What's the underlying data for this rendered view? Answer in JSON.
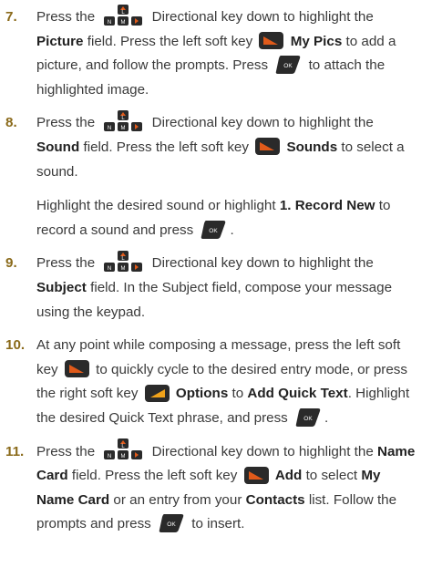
{
  "colors": {
    "step_number": "#8a6a1a",
    "text": "#3a3a3a",
    "key_dark": "#2a2a2a",
    "key_accent": "#e05a1a"
  },
  "icons": {
    "directional": "directional-key-icon",
    "left_soft": "left-soft-key-icon",
    "right_soft": "right-soft-key-icon",
    "ok": "ok-key-icon"
  },
  "keys": {
    "dir_top": "L",
    "dir_left": "N",
    "dir_mid": "M",
    "ok": "OK"
  },
  "steps": [
    {
      "num": "7.",
      "t1": "Press the",
      "t2": "Directional key down to highlight the",
      "b1": "Picture",
      "t3": "field. Press the left soft key",
      "b2": "My Pics",
      "t4": "to add a picture, and follow the prompts. Press",
      "t5": "to attach the highlighted image."
    },
    {
      "num": "8.",
      "t1": "Press the",
      "t2": "Directional key down to highlight the",
      "b1": "Sound",
      "t3": "field. Press the left soft key",
      "b2": "Sounds",
      "t4": "to select a sound.",
      "s1": "Highlight the desired sound or highlight",
      "sb1": "1. Record New",
      "s2": "to record a sound and press",
      "s3": "."
    },
    {
      "num": "9.",
      "t1": "Press the",
      "t2": "Directional key down to highlight the",
      "b1": "Subject",
      "t3": "field. In the Subject field, compose your message using the keypad."
    },
    {
      "num": "10.",
      "t1": "At any point while composing a message, press the left soft key",
      "t2": "to quickly cycle to the desired entry mode, or press the right soft key",
      "b1": "Options",
      "t3": "to",
      "b2": "Add Quick Text",
      "t4": ". Highlight the desired Quick Text phrase, and press",
      "t5": "."
    },
    {
      "num": "11.",
      "t1": "Press the",
      "t2": "Directional key down to highlight the",
      "b1": "Name Card",
      "t3": "field. Press the left soft key",
      "b2": "Add",
      "t4": "to select",
      "b3": "My Name Card",
      "t5": "or an entry from your",
      "b4": "Contacts",
      "t6": "list. Follow the prompts and press",
      "t7": "to insert."
    }
  ]
}
